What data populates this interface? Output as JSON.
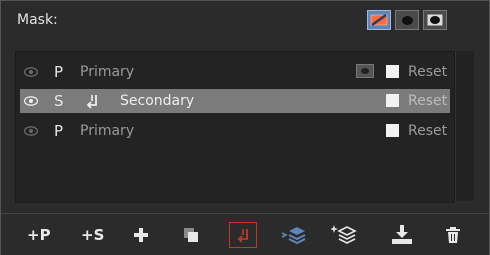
{
  "header": {
    "title": "Mask:",
    "mask_buttons": [
      {
        "icon": "no-mask-icon",
        "active": true
      },
      {
        "icon": "filled-mask-icon",
        "active": false
      },
      {
        "icon": "outline-mask-icon",
        "active": false
      }
    ]
  },
  "rows": [
    {
      "code": "P",
      "name": "Primary",
      "has_revert_icon": false,
      "has_mask_icon": true,
      "reset": "Reset",
      "selected": false
    },
    {
      "code": "S",
      "name": "Secondary",
      "has_revert_icon": true,
      "has_mask_icon": false,
      "reset": "Reset",
      "selected": true
    },
    {
      "code": "P",
      "name": "Primary",
      "has_revert_icon": false,
      "has_mask_icon": false,
      "reset": "Reset",
      "selected": false
    }
  ],
  "toolbar": {
    "add_primary": "+P",
    "add_secondary": "+S",
    "icons": [
      "add-icon",
      "duplicate-icon",
      "revert-icon",
      "layers-icon",
      "layers-sparkle-icon",
      "download-icon",
      "trash-icon"
    ]
  },
  "colors": {
    "accent_blue": "#5f86b8",
    "accent_red": "#c0392b",
    "selected_row": "#7b7b7b"
  }
}
